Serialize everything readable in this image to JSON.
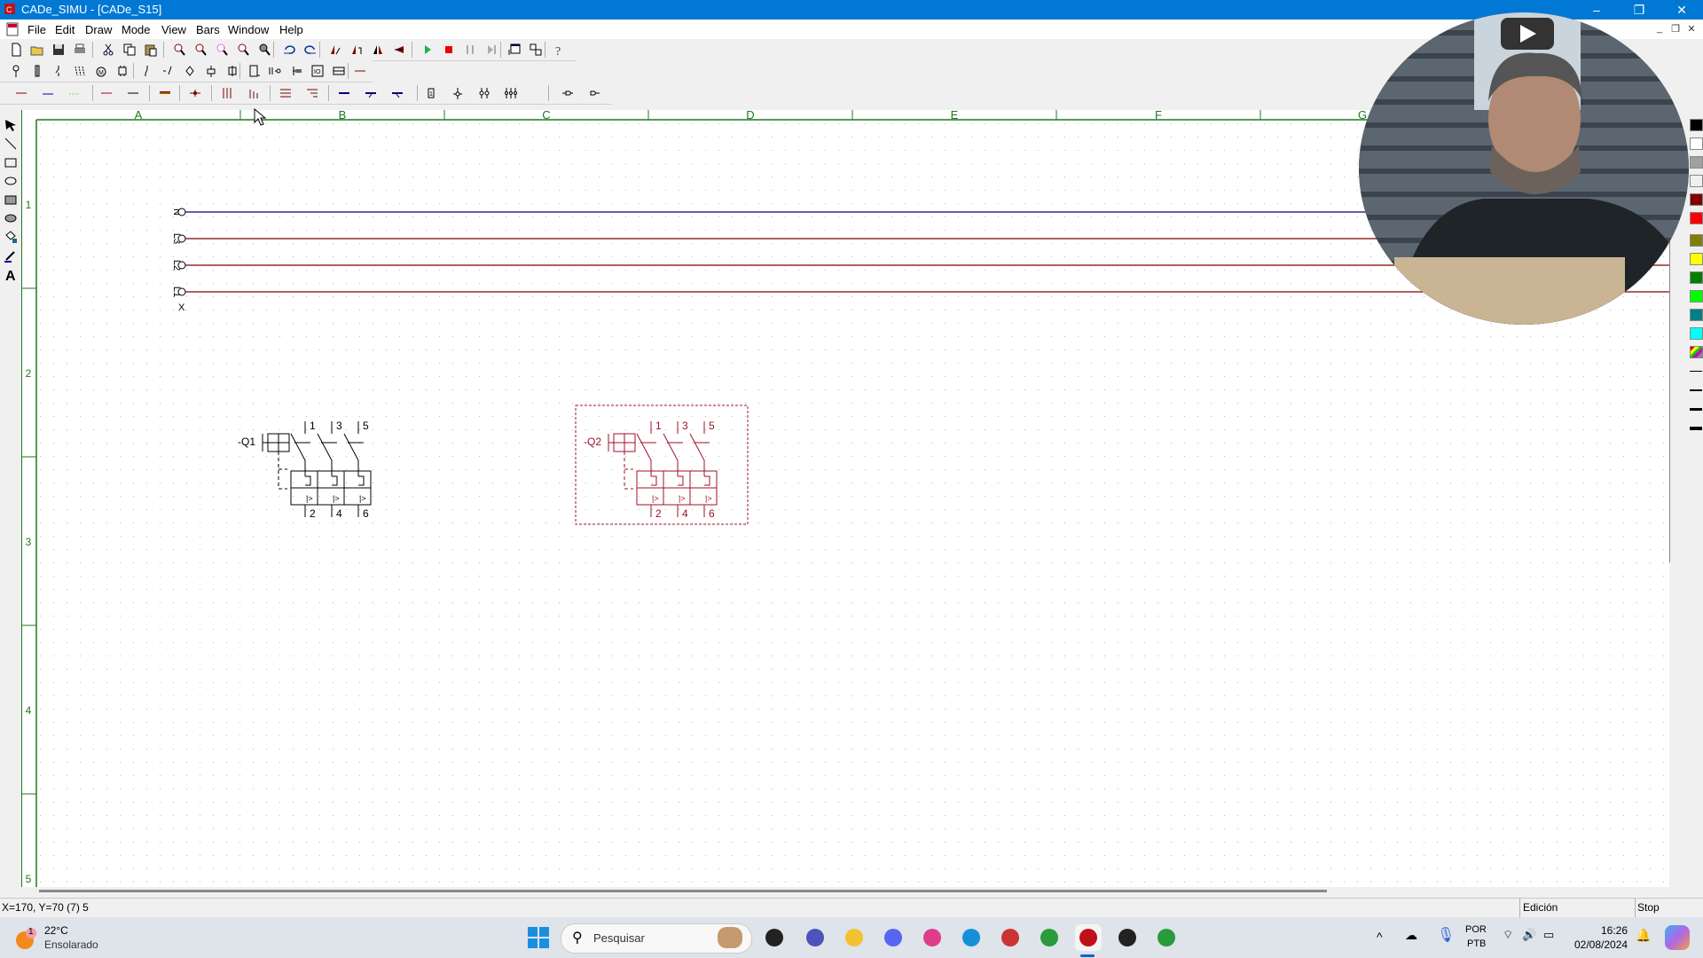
{
  "window": {
    "title": "CADe_SIMU - [CADe_S15]",
    "controls": {
      "minimize": "–",
      "restore": "❐",
      "close": "✕"
    }
  },
  "menubar": {
    "items": [
      "File",
      "Edit",
      "Draw",
      "Mode",
      "View",
      "Bars",
      "Window",
      "Help"
    ],
    "mdi_controls": [
      "_",
      "❐",
      "✕"
    ]
  },
  "toolbar_main": {
    "buttons": [
      "new-icon",
      "open-icon",
      "save-icon",
      "print-icon",
      "cut-icon",
      "copy-icon",
      "paste-icon",
      "zoom-in-icon",
      "zoom-out-icon",
      "zoom-window-icon",
      "zoom-all-icon",
      "zoom-extents-icon",
      "undo-icon",
      "redo-icon",
      "rotate-left-icon",
      "rotate-right-icon",
      "mirror-h-icon",
      "mirror-v-icon",
      "simulate-play-icon",
      "simulate-stop-icon",
      "simulate-pause-icon",
      "simulate-step-icon",
      "window-cascade-icon",
      "window-tile-icon",
      "help-icon"
    ]
  },
  "toolbar_components": {
    "buttons": [
      "supply-icon",
      "fuse-icon",
      "switch-icon",
      "three-phase-switch-icon",
      "motor-icon",
      "contactor-coil-icon",
      "no-contact-icon",
      "pushbutton-icon",
      "sensor-icon",
      "relay-icon",
      "timer-icon",
      "plc-icon",
      "connector-icon",
      "terminal-icon",
      "io-icon",
      "cable-icon",
      "wire-icon"
    ]
  },
  "toolbar_wires": {
    "buttons": [
      "wire-red-icon",
      "wire-blue-icon",
      "wire-green-dashed-icon",
      "wire-darkred-icon",
      "wire-black-icon",
      "wire-thick-icon",
      "junction-icon",
      "three-wires-icon",
      "three-wires-offset-icon",
      "bus-horizontal-icon",
      "bus-horizontal-offset-icon",
      "wire-navy-icon",
      "wire-navy-branch-icon",
      "wire-navy-branch2-icon",
      "terminal-single-icon",
      "terminal-numbered-icon",
      "terminal-triple-icon",
      "terminal-quad-icon",
      "connector-male-icon",
      "connector-female-icon"
    ]
  },
  "left_tools": [
    "select-icon",
    "line-icon",
    "rectangle-icon",
    "ellipse-icon",
    "filled-rectangle-icon",
    "filled-ellipse-icon",
    "fill-color-icon",
    "line-color-icon",
    "text-icon"
  ],
  "sheet": {
    "columns": [
      "A",
      "B",
      "C",
      "D",
      "E",
      "F",
      "G"
    ],
    "rows": [
      "1",
      "2",
      "3",
      "4",
      "5"
    ],
    "border_color": "#1e7a1e",
    "supply_lines": [
      {
        "label": "N",
        "color": "#000080"
      },
      {
        "label": "L3",
        "color": "#800000"
      },
      {
        "label": "L2",
        "color": "#800000"
      },
      {
        "label": "L1",
        "color": "#800000"
      }
    ],
    "pe_label": "X",
    "components": [
      {
        "tag": "-Q1",
        "top_terminals": [
          "1",
          "3",
          "5"
        ],
        "bottom_terminals": [
          "2",
          "4",
          "6"
        ],
        "color": "#000000",
        "selected": false
      },
      {
        "tag": "-Q2",
        "top_terminals": [
          "1",
          "3",
          "5"
        ],
        "bottom_terminals": [
          "2",
          "4",
          "6"
        ],
        "color": "#a01028",
        "selected": true
      }
    ]
  },
  "palette": {
    "colors": [
      "#000000",
      "#ffffff",
      "#a0a0a0",
      "#f0f0f0",
      "#800000",
      "#ff0000",
      "#808000",
      "#ffff00",
      "#008000",
      "#00ff00",
      "#008080",
      "#00ffff"
    ],
    "multicolor": "multi-color-icon",
    "line_widths": [
      1,
      2,
      3,
      4
    ]
  },
  "statusbar": {
    "coords": "X=170, Y=70 (7) 5",
    "mode": "Edición",
    "sim_state": "Stop"
  },
  "taskbar": {
    "weather": {
      "temp": "22°C",
      "desc": "Ensolarado",
      "badge": "1"
    },
    "search_placeholder": "Pesquisar",
    "apps": [
      "task-view-icon",
      "teams-icon",
      "file-explorer-icon",
      "discord-icon",
      "adobe-cc-icon",
      "skype-icon",
      "snipping-tool-icon",
      "chrome-icon",
      "cade-simu-icon",
      "obs-icon",
      "chrome-profile-icon"
    ],
    "tray": {
      "lang_top": "POR",
      "lang_bottom": "PTB",
      "time": "16:26",
      "date": "02/08/2024"
    }
  }
}
